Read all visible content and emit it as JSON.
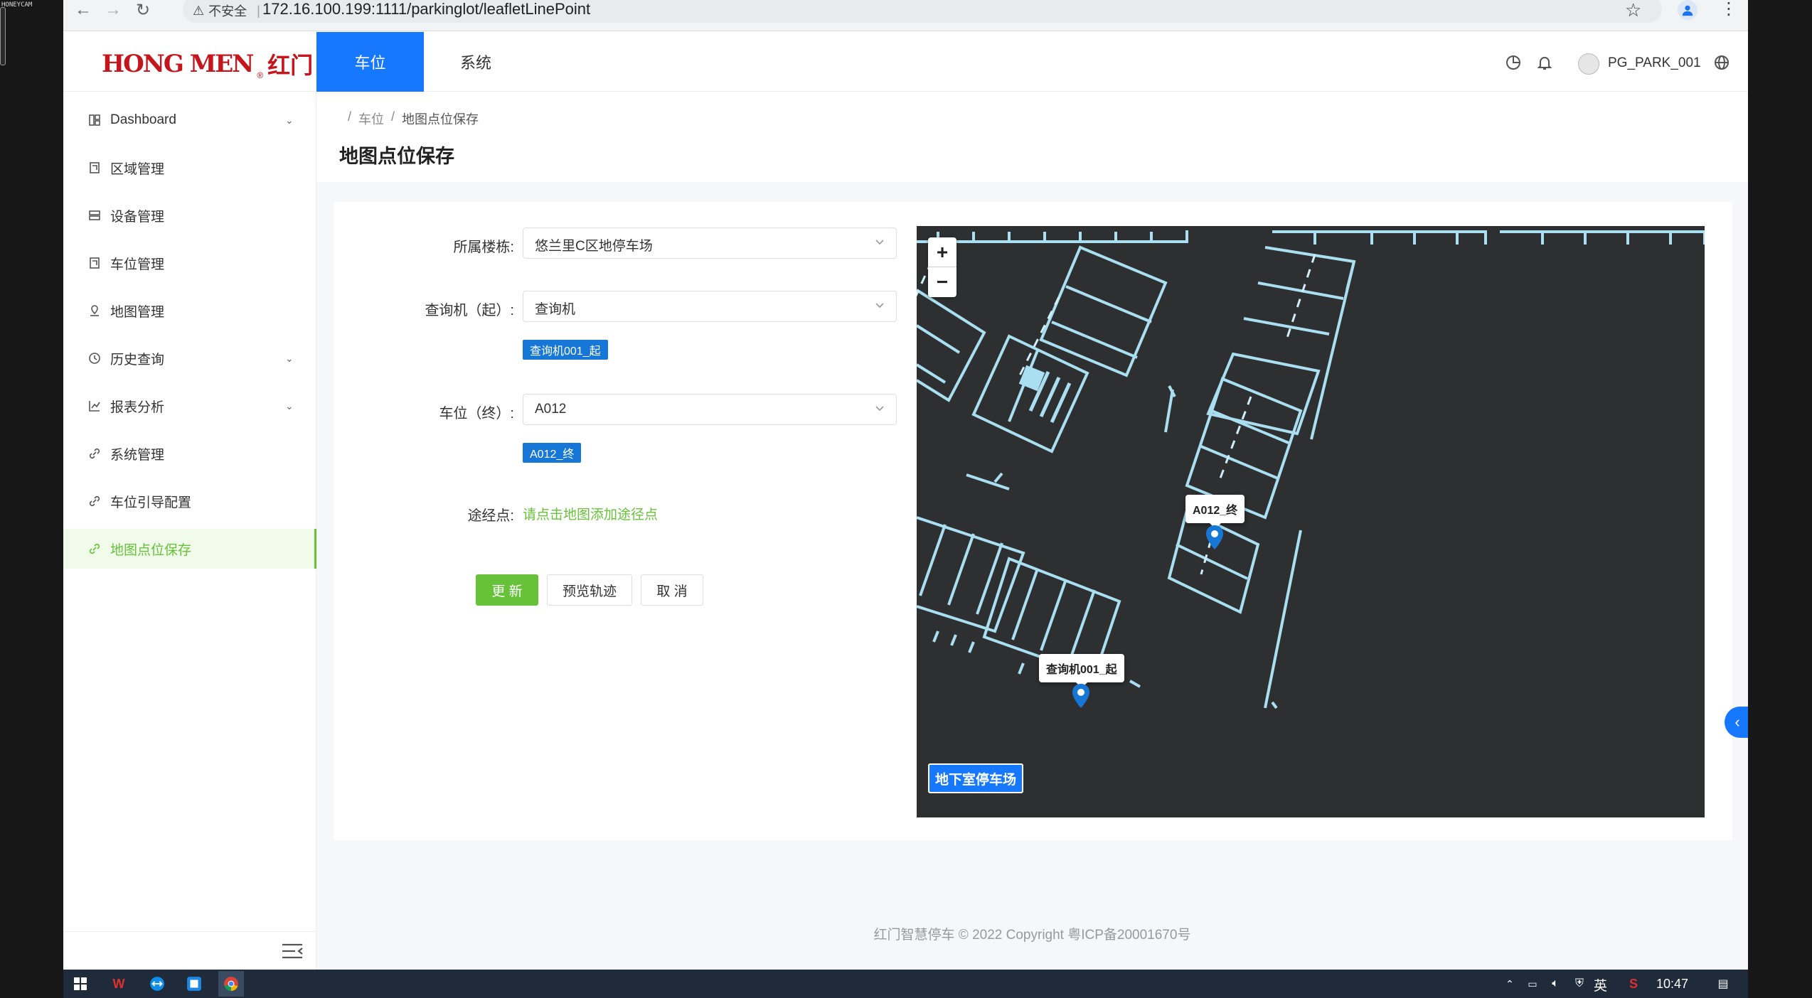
{
  "watermark": "HONEYCAM",
  "browser": {
    "insecure_label": "不安全",
    "url": "172.16.100.199:1111/parkinglot/leafletLinePoint"
  },
  "header": {
    "logo_text": "HONG MEN",
    "logo_cn": "红门",
    "logo_reg": "®",
    "tabs": [
      {
        "label": "车位",
        "active": true
      },
      {
        "label": "系统",
        "active": false
      }
    ],
    "user_name": "PG_PARK_001"
  },
  "sidebar": {
    "items": [
      {
        "label": "Dashboard",
        "icon": "dashboard-icon",
        "has_arrow": true
      },
      {
        "label": "区域管理",
        "icon": "area-icon",
        "has_arrow": false
      },
      {
        "label": "设备管理",
        "icon": "server-icon",
        "has_arrow": false
      },
      {
        "label": "车位管理",
        "icon": "space-icon",
        "has_arrow": false
      },
      {
        "label": "地图管理",
        "icon": "map-icon",
        "has_arrow": false
      },
      {
        "label": "历史查询",
        "icon": "clock-icon",
        "has_arrow": true
      },
      {
        "label": "报表分析",
        "icon": "chart-icon",
        "has_arrow": true
      },
      {
        "label": "系统管理",
        "icon": "link-icon",
        "has_arrow": false
      },
      {
        "label": "车位引导配置",
        "icon": "link-icon",
        "has_arrow": false
      },
      {
        "label": "地图点位保存",
        "icon": "link-icon",
        "has_arrow": false,
        "active": true
      }
    ]
  },
  "breadcrumb": {
    "sep": "/",
    "parent": "车位",
    "current": "地图点位保存"
  },
  "page_title": "地图点位保存",
  "form": {
    "building_label": "所属楼栋:",
    "building_value": "悠兰里C区地停车场",
    "start_label": "查询机（起）:",
    "start_value": "查询机",
    "start_tag": "查询机001_起",
    "end_label": "车位（终）:",
    "end_value": "A012",
    "end_tag": "A012_终",
    "via_label": "途经点:",
    "via_hint": "请点击地图添加途径点",
    "btn_update": "更 新",
    "btn_preview": "预览轨迹",
    "btn_cancel": "取 消"
  },
  "map": {
    "zoom_in": "+",
    "zoom_out": "−",
    "layer_label": "地下室停车场",
    "marker_end": "A012_终",
    "marker_start": "查询机001_起"
  },
  "footer": "红门智慧停车 © 2022 Copyright 粤ICP备20001670号",
  "taskbar": {
    "ime": "英",
    "clock": "10:47"
  },
  "colors": {
    "primary": "#1677ff",
    "accent_green": "#67c23a",
    "brand_red": "#c4161c",
    "map_bg": "#2d2f31",
    "map_lines": "#a9dff0"
  }
}
